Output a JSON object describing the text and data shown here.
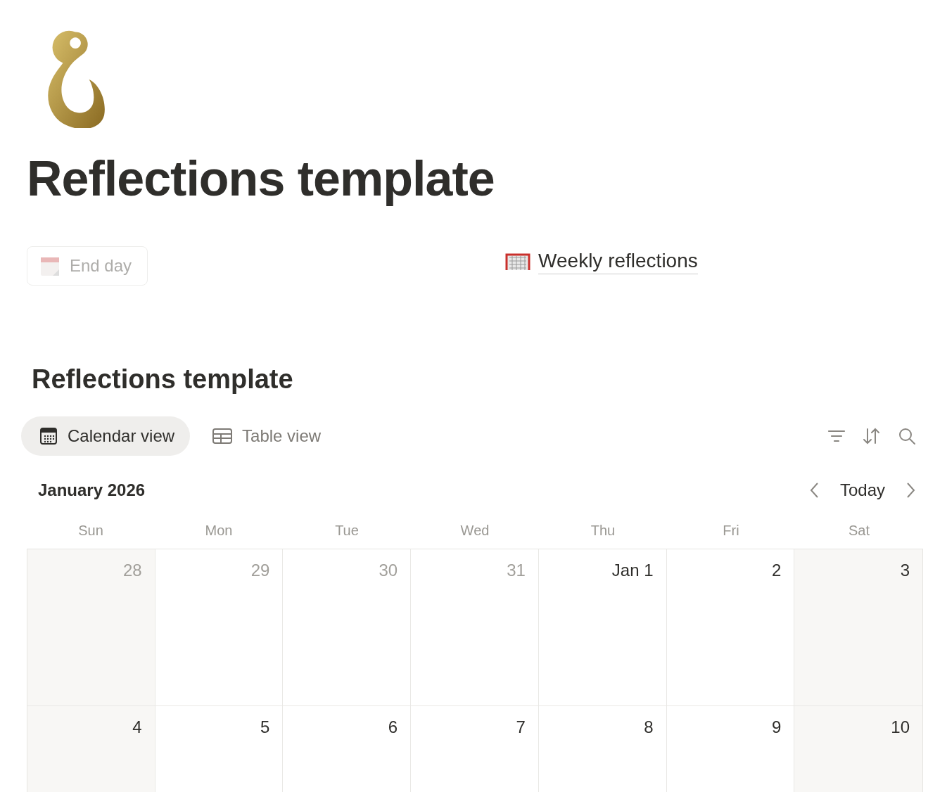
{
  "page": {
    "title": "Reflections template"
  },
  "actions": {
    "button": {
      "label": "End day",
      "disabled": true
    },
    "link": {
      "label": "Weekly reflections"
    }
  },
  "database": {
    "title": "Reflections template",
    "tabs": [
      {
        "label": "Calendar view",
        "kind": "calendar",
        "selected": true
      },
      {
        "label": "Table view",
        "kind": "table",
        "selected": false
      }
    ],
    "calendar": {
      "month": "January 2026",
      "today": "Today",
      "weekdays": [
        "Sun",
        "Mon",
        "Tue",
        "Wed",
        "Thu",
        "Fri",
        "Sat"
      ],
      "weeks": [
        [
          {
            "label": "28",
            "outside_month": true
          },
          {
            "label": "29",
            "outside_month": true
          },
          {
            "label": "30",
            "outside_month": true
          },
          {
            "label": "31",
            "outside_month": true
          },
          {
            "label": "Jan 1",
            "outside_month": false
          },
          {
            "label": "2",
            "outside_month": false
          },
          {
            "label": "3",
            "outside_month": false
          }
        ],
        [
          {
            "label": "4",
            "outside_month": false
          },
          {
            "label": "5",
            "outside_month": false
          },
          {
            "label": "6",
            "outside_month": false
          },
          {
            "label": "7",
            "outside_month": false
          },
          {
            "label": "8",
            "outside_month": false
          },
          {
            "label": "9",
            "outside_month": false
          },
          {
            "label": "10",
            "outside_month": false
          }
        ]
      ]
    }
  }
}
